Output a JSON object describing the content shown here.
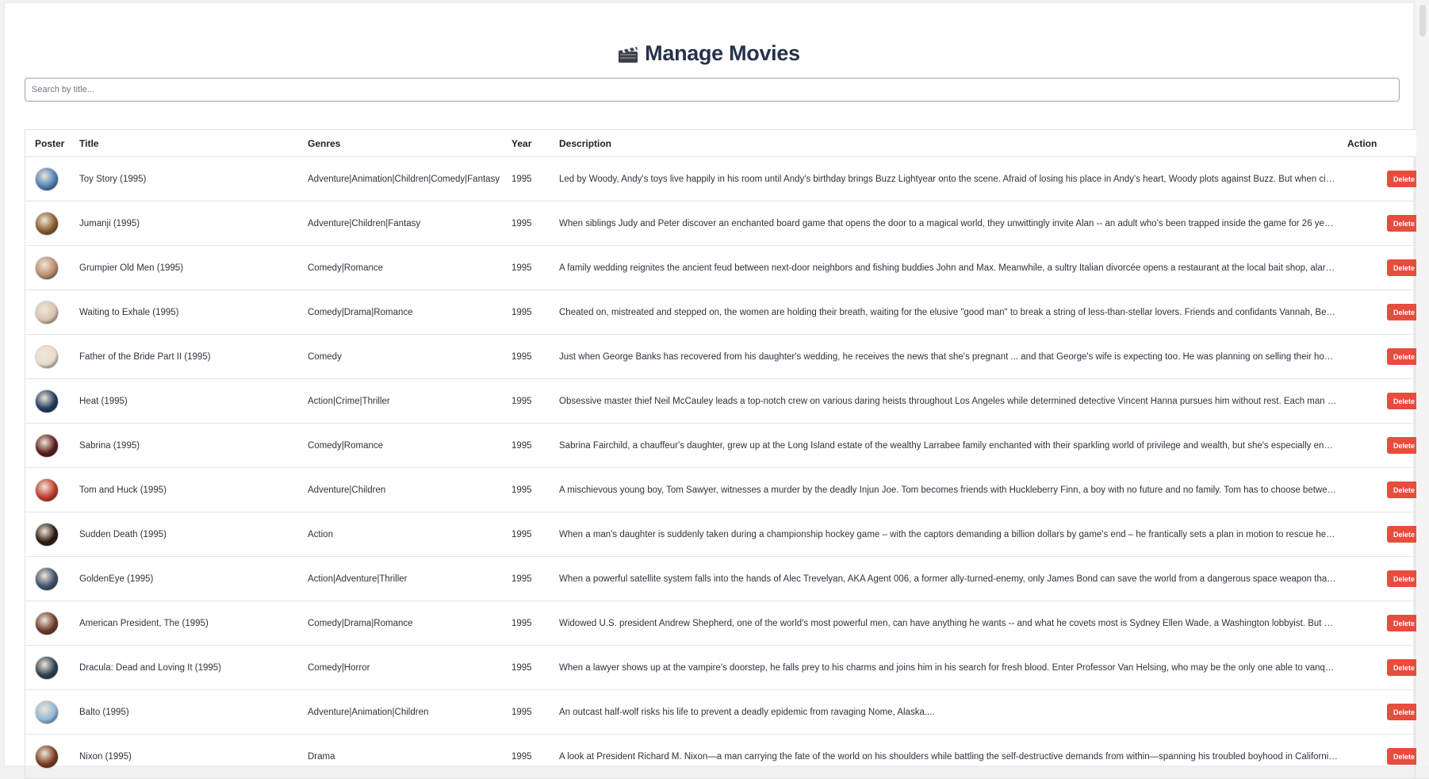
{
  "page": {
    "title": "Manage Movies",
    "title_icon": "clapperboard-icon"
  },
  "search": {
    "placeholder": "Search by title...",
    "value": ""
  },
  "table": {
    "columns": [
      "Poster",
      "Title",
      "Genres",
      "Year",
      "Description",
      "Action"
    ],
    "delete_label": "Delete",
    "delete_color": "#e74c3c",
    "rows": [
      {
        "poster": "poster-image",
        "poster_color": "#4a7fb5",
        "title": "Toy Story (1995)",
        "genres": "Adventure|Animation|Children|Comedy|Fantasy",
        "year": "1995",
        "description": "Led by Woody, Andy's toys live happily in his room until Andy's birthday brings Buzz Lightyear onto the scene. Afraid of losing his place in Andy's heart, Woody plots against Buzz. But when circumstan..."
      },
      {
        "poster": "poster-image",
        "poster_color": "#8a5a2b",
        "title": "Jumanji (1995)",
        "genres": "Adventure|Children|Fantasy",
        "year": "1995",
        "description": "When siblings Judy and Peter discover an enchanted board game that opens the door to a magical world, they unwittingly invite Alan -- an adult who's been trapped inside the game for 26 years -- into t..."
      },
      {
        "poster": "poster-image",
        "poster_color": "#b98a6a",
        "title": "Grumpier Old Men (1995)",
        "genres": "Comedy|Romance",
        "year": "1995",
        "description": "A family wedding reignites the ancient feud between next-door neighbors and fishing buddies John and Max. Meanwhile, a sultry Italian divorcée opens a restaurant at the local bait shop, alarming the l..."
      },
      {
        "poster": "poster-image",
        "poster_color": "#d9c3b0",
        "title": "Waiting to Exhale (1995)",
        "genres": "Comedy|Drama|Romance",
        "year": "1995",
        "description": "Cheated on, mistreated and stepped on, the women are holding their breath, waiting for the elusive \"good man\" to break a string of less-than-stellar lovers. Friends and confidants Vannah, Bernie, Glo ..."
      },
      {
        "poster": "poster-image",
        "poster_color": "#e8dccb",
        "title": "Father of the Bride Part II (1995)",
        "genres": "Comedy",
        "year": "1995",
        "description": "Just when George Banks has recovered from his daughter's wedding, he receives the news that she's pregnant ... and that George's wife is expecting too. He was planning on selling their home, but that'..."
      },
      {
        "poster": "poster-image",
        "poster_color": "#1f3a5a",
        "title": "Heat (1995)",
        "genres": "Action|Crime|Thriller",
        "year": "1995",
        "description": "Obsessive master thief Neil McCauley leads a top-notch crew on various daring heists throughout Los Angeles while determined detective Vincent Hanna pursues him without rest. Each man recognizes and r..."
      },
      {
        "poster": "poster-image",
        "poster_color": "#5a1a1a",
        "title": "Sabrina (1995)",
        "genres": "Comedy|Romance",
        "year": "1995",
        "description": "Sabrina Fairchild, a chauffeur's daughter, grew up at the Long Island estate of the wealthy Larrabee family enchanted with their sparkling world of privilege and wealth, but she's especially enamored ..."
      },
      {
        "poster": "poster-image",
        "poster_color": "#c0392b",
        "title": "Tom and Huck (1995)",
        "genres": "Adventure|Children",
        "year": "1995",
        "description": "A mischievous young boy, Tom Sawyer, witnesses a murder by the deadly Injun Joe. Tom becomes friends with Huckleberry Finn, a boy with no future and no family. Tom has to choose between honoring a fri..."
      },
      {
        "poster": "poster-image",
        "poster_color": "#2a1a10",
        "title": "Sudden Death (1995)",
        "genres": "Action",
        "year": "1995",
        "description": "When a man's daughter is suddenly taken during a championship hockey game – with the captors demanding a billion dollars by game's end – he frantically sets a plan in motion to rescue her and abort an..."
      },
      {
        "poster": "poster-image",
        "poster_color": "#3d4f6b",
        "title": "GoldenEye (1995)",
        "genres": "Action|Adventure|Thriller",
        "year": "1995",
        "description": "When a powerful satellite system falls into the hands of Alec Trevelyan, AKA Agent 006, a former ally-turned-enemy, only James Bond can save the world from a dangerous space weapon that -- in one shor..."
      },
      {
        "poster": "poster-image",
        "poster_color": "#6b3a2a",
        "title": "American President, The (1995)",
        "genres": "Comedy|Drama|Romance",
        "year": "1995",
        "description": "Widowed U.S. president Andrew Shepherd, one of the world's most powerful men, can have anything he wants -- and what he covets most is Sydney Ellen Wade, a Washington lobbyist. But Shepherd's attempts..."
      },
      {
        "poster": "poster-image",
        "poster_color": "#2c3e50",
        "title": "Dracula: Dead and Loving It (1995)",
        "genres": "Comedy|Horror",
        "year": "1995",
        "description": "When a lawyer shows up at the vampire's doorstep, he falls prey to his charms and joins him in his search for fresh blood. Enter Professor Van Helsing, who may be the only one able to vanquish the Cou..."
      },
      {
        "poster": "poster-image",
        "poster_color": "#8fb8d8",
        "title": "Balto (1995)",
        "genres": "Adventure|Animation|Children",
        "year": "1995",
        "description": "An outcast half-wolf risks his life to prevent a deadly epidemic from ravaging Nome, Alaska...."
      },
      {
        "poster": "poster-image",
        "poster_color": "#7a3b1e",
        "title": "Nixon (1995)",
        "genres": "Drama",
        "year": "1995",
        "description": "A look at President Richard M. Nixon—a man carrying the fate of the world on his shoulders while battling the self-destructive demands from within—spanning his troubled boyhood in California to the sh..."
      }
    ]
  }
}
